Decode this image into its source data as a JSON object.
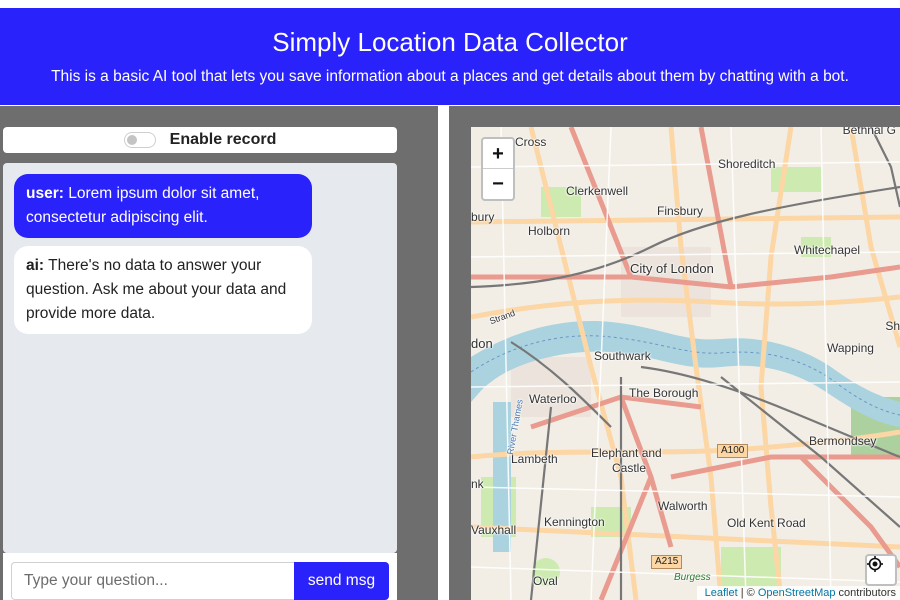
{
  "header": {
    "title": "Simply Location Data Collector",
    "subtitle": "This is a basic AI tool that lets you save information about a places and get details about them by chatting with a bot."
  },
  "record": {
    "label": "Enable record",
    "enabled": false
  },
  "chat": {
    "messages": [
      {
        "role_label": "user:",
        "text": " Lorem ipsum dolor sit amet, consectetur adipiscing elit."
      },
      {
        "role_label": "ai:",
        "text": " There's no data to answer your question. Ask me about your data and provide more data."
      }
    ]
  },
  "input": {
    "placeholder": "Type your question...",
    "value": ""
  },
  "send_label": "send msg",
  "map": {
    "zoom_in": "+",
    "zoom_out": "−",
    "attribution": {
      "leaflet": "Leaflet",
      "separator": " | © ",
      "osm": "OpenStreetMap",
      "suffix": " contributors"
    },
    "labels": {
      "bethnal": "Bethnal G",
      "cross": "Cross",
      "shoreditch": "Shoreditch",
      "clerkenwell": "Clerkenwell",
      "finsbury": "Finsbury",
      "bury": "bury",
      "holborn": "Holborn",
      "whitechapel": "Whitechapel",
      "city": "City of London",
      "sh": "Sh",
      "strand": "Strand",
      "don": "don",
      "southwark": "Southwark",
      "wapping": "Wapping",
      "waterloo": "Waterloo",
      "borough": "The Borough",
      "bermondsey": "Bermondsey",
      "a100": "A100",
      "elephant": "Elephant and",
      "castle": "Castle",
      "lambeth": "Lambeth",
      "nk": "nk",
      "walworth": "Walworth",
      "kennington": "Kennington",
      "oldkent": "Old Kent Road",
      "vauxhall": "Vauxhall",
      "a215": "A215",
      "burgess": "Burgess",
      "oval": "Oval",
      "river": "River Thames"
    }
  },
  "colors": {
    "brand": "#2a22fb",
    "panel": "#6e6e6e",
    "chat_bg": "#e6e9ee"
  }
}
